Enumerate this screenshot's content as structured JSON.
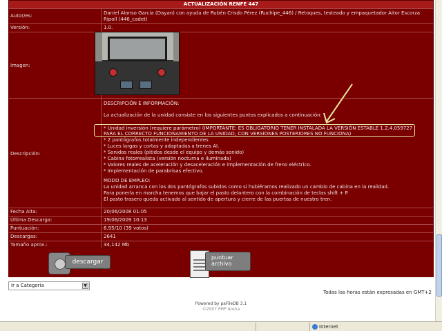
{
  "title": "ACTUALIZACIÓN RENFE 447",
  "fields": {
    "autor_label": "Autor/es:",
    "autor_value": "Daniel Alonso García (Dayan) con ayuda de Rubén Crisdo Pérez (Ruchipe_446) / Retoques, testeado y empaquetador Aitor Escorza Ripoll (446_cadet)",
    "version_label": "Versión:",
    "version_value": "1.0.",
    "imagen_label": "Imagen:",
    "descripcion_label": "Descripción:",
    "desc_heading": "DESCRIPCIÓN E INFORMACIÓN:",
    "desc_intro": "La actualización de la unidad consiste en los siguientes puntos explicados a continuación:",
    "desc_lines": [
      "* Unidad inversión (requiere parámetro)  (IMPORTANTE: ES OBLIGATORIO TENER INSTALADA LA VERSIÓN ESTABLE 1.2.4.059727",
      "PARA EL CORRECTO FUNCIONAMIENTO DE LA UNIDAD, CON VERSIONES POSTERIORES NO FUNCIONA)",
      "* 2 pantógrafos totalmente independientes",
      "* Luces largas y cortas y adaptadas a trenes AI.",
      "* Sonidos reales (pitidos desde el equipo y demás sonido)",
      "* Cabina fotorrealista (versión nocturna e iluminada)",
      "* Valores reales de aceleración y desaceleración e implementación de freno eléctrico.",
      "* Implementación de parabrisas efectivo."
    ],
    "modo_heading": "MODO DE EMPLEO:",
    "modo_lines": [
      "La unidad arranca con los dos pantógrafos subidos como si hubiéramos realizado un cambio de cabina en la realidad.",
      "Para ponerla en marcha tenemos que bajar el pasto delantero con la combinación de teclas shift + P.",
      "El pasto trasero queda activado al sentido de apertura y cierre de las puertas de nuestro tren."
    ],
    "fecha_alta_label": "Fecha Alta:",
    "fecha_alta_value": "20/06/2008 01:05",
    "ultima_label": "Última Descarga:",
    "ultima_value": "19/06/2009 10:13",
    "puntuacion_label": "Puntuación:",
    "puntuacion_value": "6.95/10 (39 votos)",
    "descargas_label": "Descargas:",
    "descargas_value": "2641",
    "tamano_label": "Tamaño aprox.:",
    "tamano_value": "34,142 Mb"
  },
  "buttons": {
    "download": "descargar",
    "rate_line1": "puntuar",
    "rate_line2": "archivo"
  },
  "footer": {
    "jump_select": "Ir a Categoría",
    "timezone": "Todas las horas están expresadas en GMT+2",
    "powered": "Powered by paFileDB 3.1",
    "powered_sub": "©2007 PHP Arena"
  },
  "statusbar": {
    "zone": "Internet"
  },
  "colors": {
    "background": "#7a0000",
    "title_bar": "#a61a1a",
    "annotation": "#e8e8a0"
  }
}
